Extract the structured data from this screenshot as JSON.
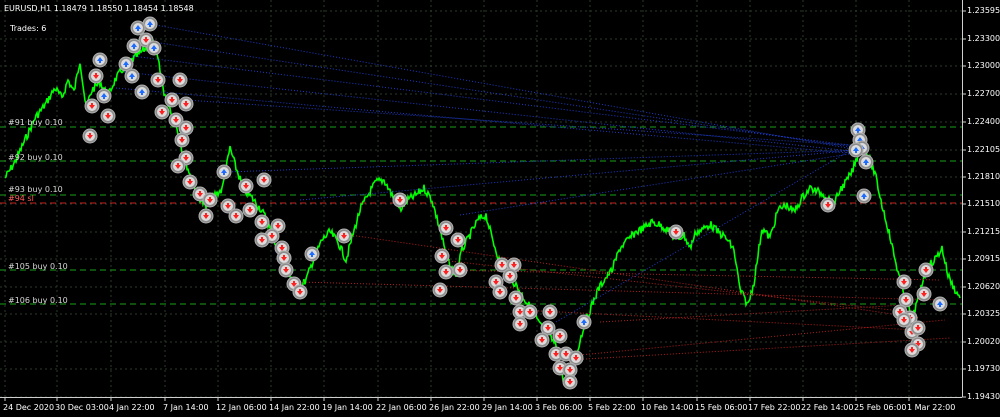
{
  "header": {
    "symbol_timeframe": "EURUSD,H1",
    "ohlc": "1.18479 1.18550 1.18454 1.18548",
    "trades": "Trades: 6"
  },
  "price_axis": {
    "labels": [
      "1.23595",
      "1.23300",
      "1.23000",
      "1.22700",
      "1.22400",
      "1.22105",
      "1.21810",
      "1.21510",
      "1.21215",
      "1.20915",
      "1.20620",
      "1.20325",
      "1.20020",
      "1.19730",
      "1.19430"
    ]
  },
  "time_axis": {
    "labels": [
      "24 Dec 2020",
      "30 Dec 03:00",
      "4 Jan 22:00",
      "7 Jan 14:00",
      "12 Jan 06:00",
      "14 Jan 22:00",
      "19 Jan 14:00",
      "22 Jan 06:00",
      "26 Jan 22:00",
      "29 Jan 14:00",
      "3 Feb 06:00",
      "5 Feb 22:00",
      "10 Feb 14:00",
      "15 Feb 06:00",
      "17 Feb 22:00",
      "22 Feb 14:00",
      "25 Feb 06:00",
      "1 Mar 22:00"
    ]
  },
  "order_lines": [
    {
      "label": "#91 buy 0.10",
      "color": "#1aa01a"
    },
    {
      "label": "#92 buy 0.10",
      "color": "#1aa01a"
    },
    {
      "label": "#93 buy 0.10",
      "color": "#1aa01a"
    },
    {
      "label": "#94 sl",
      "color": "#c81e1e"
    },
    {
      "label": "#105 buy 0.10",
      "color": "#1aa01a"
    },
    {
      "label": "#106 buy 0.10",
      "color": "#1aa01a"
    }
  ],
  "colors": {
    "background": "#000000",
    "price_line": "#00ff00",
    "grid": "#2a3a2a",
    "buy_arrow": "#1e6bff",
    "sell_arrow": "#ff2020",
    "marker_ring": "#b0b0b0",
    "trade_link_buy": "#1e3cc8",
    "trade_link_sell": "#b41e1e"
  },
  "icons": {
    "buy_marker": "up-arrow-icon",
    "sell_marker": "down-arrow-icon"
  }
}
